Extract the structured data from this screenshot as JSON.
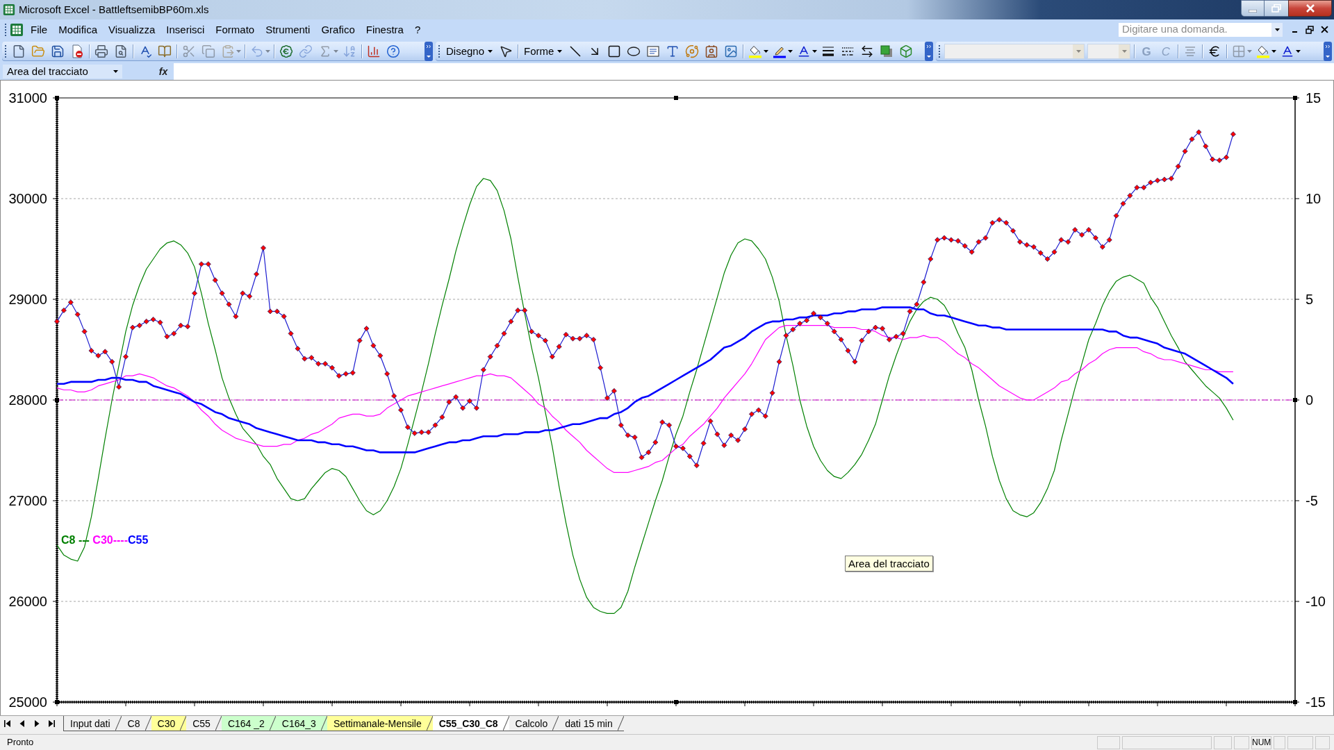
{
  "window": {
    "title": "Microsoft Excel - BattleftsemibBP60m.xls"
  },
  "menu_bar": {
    "items": [
      "File",
      "Modifica",
      "Visualizza",
      "Inserisci",
      "Formato",
      "Strumenti",
      "Grafico",
      "Finestra",
      "?"
    ],
    "help_box": {
      "placeholder": "Digitare una domanda."
    }
  },
  "toolbars": {
    "standard": [
      [
        {
          "kind": "new",
          "disabled": false
        },
        {
          "kind": "open",
          "disabled": false
        },
        {
          "kind": "save",
          "disabled": false
        },
        {
          "kind": "permission",
          "disabled": false
        }
      ],
      [
        {
          "kind": "print",
          "disabled": false
        },
        {
          "kind": "print_preview",
          "disabled": false
        }
      ],
      [
        {
          "kind": "spelling",
          "disabled": false
        },
        {
          "kind": "research",
          "disabled": false
        }
      ],
      [
        {
          "kind": "cut",
          "disabled": true
        },
        {
          "kind": "copy",
          "disabled": true
        },
        {
          "kind": "paste",
          "disabled": true
        }
      ],
      [
        {
          "kind": "undo",
          "disabled": true
        }
      ],
      [
        {
          "kind": "euro_conversion",
          "disabled": false
        },
        {
          "kind": "hyperlink",
          "disabled": true
        },
        {
          "kind": "autosum",
          "disabled": true
        },
        {
          "kind": "sort",
          "disabled": true
        }
      ],
      [
        {
          "kind": "chart_wizard",
          "disabled": false
        },
        {
          "kind": "help",
          "disabled": false
        }
      ]
    ],
    "drawing": [
      [
        {
          "kind": "menu",
          "label": "Disegno",
          "disabled": false
        },
        {
          "kind": "pointer",
          "disabled": false
        }
      ],
      [
        {
          "kind": "menu",
          "label": "Forme",
          "disabled": false
        },
        {
          "kind": "line",
          "disabled": false
        },
        {
          "kind": "arrow",
          "disabled": false
        },
        {
          "kind": "rectangle",
          "disabled": false
        },
        {
          "kind": "oval",
          "disabled": false
        },
        {
          "kind": "text_box",
          "disabled": false
        },
        {
          "kind": "wordart",
          "disabled": false
        },
        {
          "kind": "diagram",
          "disabled": false
        },
        {
          "kind": "clip_art",
          "disabled": false
        },
        {
          "kind": "picture",
          "disabled": false
        }
      ],
      [
        {
          "kind": "fill_color",
          "disabled": false
        },
        {
          "kind": "line_color",
          "disabled": false
        },
        {
          "kind": "font_color",
          "disabled": false
        },
        {
          "kind": "line_style",
          "disabled": false
        },
        {
          "kind": "dash_style",
          "disabled": false
        },
        {
          "kind": "arrow_style",
          "disabled": false
        },
        {
          "kind": "shadow",
          "disabled": false
        },
        {
          "kind": "three_d",
          "disabled": false
        }
      ]
    ],
    "formatting": [
      [
        {
          "kind": "font_combo",
          "disabled": true
        },
        {
          "kind": "size_combo",
          "disabled": true
        }
      ],
      [
        {
          "kind": "bold",
          "label": "G",
          "disabled": true
        },
        {
          "kind": "italic",
          "label": "C",
          "disabled": true
        }
      ],
      [
        {
          "kind": "align",
          "disabled": true
        }
      ],
      [
        {
          "kind": "euro",
          "disabled": false
        }
      ],
      [
        {
          "kind": "borders",
          "disabled": true
        },
        {
          "kind": "fill_color",
          "disabled": false
        },
        {
          "kind": "font_color",
          "disabled": false
        }
      ]
    ]
  },
  "formula_bar": {
    "name_box": "Area del tracciato",
    "function_button": "fx"
  },
  "chart": {
    "plot_area_selected": true,
    "legend_text": [
      {
        "text": "C8 --- ",
        "color": "#008000"
      },
      {
        "text": "C30----",
        "color": "#ff00ff"
      },
      {
        "text": "C55",
        "color": "#0000ff"
      }
    ],
    "tooltip": "Area del tracciato",
    "series_styles": [
      {
        "kind": "thin",
        "color": "#ff0000"
      },
      {
        "kind": "thin"
      },
      {
        "kind": "thin"
      },
      {
        "kind": "thick"
      },
      {
        "kind": "thin"
      }
    ],
    "chart_data": {
      "type": "line",
      "grid": true,
      "ylim": [
        25000,
        31000
      ],
      "yticks": [
        25000,
        26000,
        27000,
        28000,
        29000,
        30000,
        31000
      ],
      "y2lim": [
        -15,
        15
      ],
      "y2ticks": [
        -15,
        -10,
        -5,
        0,
        5,
        10,
        15
      ],
      "series": [
        {
          "color": "#1c1cd0",
          "marker": "diamond",
          "values": [
            28780,
            28890,
            28970,
            28850,
            28680,
            28490,
            28440,
            28480,
            28380,
            28130,
            28430,
            28720,
            28740,
            28780,
            28800,
            28770,
            28630,
            28660,
            28740,
            28730,
            29060,
            29350,
            29350,
            29190,
            29060,
            28950,
            28830,
            29060,
            29030,
            29250,
            29510,
            28880,
            28880,
            28830,
            28660,
            28510,
            28410,
            28420,
            28360,
            28360,
            28320,
            28240,
            28260,
            28270,
            28590,
            28710,
            28540,
            28440,
            28260,
            28040,
            27900,
            27730,
            27670,
            27680,
            27680,
            27750,
            27830,
            27980,
            28030,
            27920,
            27990,
            27920,
            28300,
            28430,
            28540,
            28660,
            28780,
            28890,
            28890,
            28680,
            28640,
            28590,
            28430,
            28530,
            28650,
            28610,
            28610,
            28640,
            28600,
            28320,
            28020,
            28090,
            27750,
            27650,
            27630,
            27430,
            27480,
            27580,
            27780,
            27750,
            27540,
            27520,
            27440,
            27350,
            27570,
            27790,
            27660,
            27550,
            27650,
            27600,
            27710,
            27860,
            27900,
            27840,
            28070,
            28380,
            28640,
            28700,
            28760,
            28790,
            28860,
            28820,
            28760,
            28680,
            28600,
            28490,
            28380,
            28590,
            28680,
            28720,
            28710,
            28600,
            28630,
            28660,
            28880,
            28950,
            29170,
            29400,
            29590,
            29610,
            29590,
            29580,
            29530,
            29470,
            29570,
            29610,
            29760,
            29790,
            29760,
            29680,
            29570,
            29540,
            29520,
            29460,
            29400,
            29470,
            29590,
            29570,
            29690,
            29640,
            29690,
            29610,
            29520,
            29590,
            29830,
            29950,
            30030,
            30110,
            30110,
            30160,
            30180,
            30190,
            30200,
            30320,
            30470,
            30590,
            30660,
            30520,
            30390,
            30380,
            30410,
            30640,
            null,
            null,
            null,
            null,
            null,
            null,
            null,
            null,
            null
          ]
        },
        {
          "color": "#008000",
          "axis": "y2",
          "values": [
            -7.2,
            -7.7,
            -7.9,
            -8.0,
            -7.3,
            -5.8,
            -3.9,
            -1.9,
            0.0,
            1.7,
            3.4,
            4.7,
            5.7,
            6.5,
            7.0,
            7.5,
            7.8,
            7.9,
            7.7,
            7.3,
            6.6,
            5.3,
            3.8,
            2.5,
            1.1,
            0.1,
            -0.7,
            -1.4,
            -1.8,
            -2.2,
            -2.8,
            -3.2,
            -3.9,
            -4.4,
            -4.9,
            -5.0,
            -4.9,
            -4.4,
            -4.0,
            -3.6,
            -3.4,
            -3.5,
            -3.8,
            -4.4,
            -5.0,
            -5.5,
            -5.7,
            -5.5,
            -5.0,
            -4.3,
            -3.4,
            -2.2,
            -0.9,
            0.4,
            1.8,
            3.3,
            4.7,
            6.0,
            7.4,
            8.6,
            9.7,
            10.6,
            11.0,
            10.9,
            10.4,
            9.4,
            8.0,
            6.1,
            4.3,
            2.6,
            1.1,
            -0.6,
            -2.3,
            -4.3,
            -6.1,
            -7.7,
            -8.9,
            -9.8,
            -10.3,
            -10.5,
            -10.6,
            -10.6,
            -10.3,
            -9.5,
            -8.3,
            -7.2,
            -6.1,
            -5.0,
            -4.0,
            -2.8,
            -1.7,
            -0.8,
            0.4,
            1.5,
            2.7,
            3.9,
            5.1,
            6.3,
            7.2,
            7.8,
            8.0,
            7.9,
            7.5,
            7.0,
            6.1,
            4.9,
            3.2,
            1.7,
            0.0,
            -1.3,
            -2.3,
            -3.0,
            -3.5,
            -3.8,
            -3.9,
            -3.6,
            -3.2,
            -2.7,
            -2.0,
            -1.2,
            0.0,
            1.2,
            2.2,
            3.1,
            3.9,
            4.5,
            4.9,
            5.1,
            5.0,
            4.7,
            4.1,
            3.3,
            2.6,
            1.5,
            0.0,
            -1.3,
            -2.8,
            -4.0,
            -4.9,
            -5.5,
            -5.7,
            -5.8,
            -5.6,
            -5.1,
            -4.4,
            -3.5,
            -2.0,
            -0.7,
            0.6,
            1.8,
            3.0,
            3.8,
            4.7,
            5.4,
            5.9,
            6.1,
            6.2,
            6.0,
            5.8,
            5.1,
            4.6,
            3.9,
            3.2,
            2.6,
            1.9,
            1.5,
            1.1,
            0.7,
            0.4,
            0.1,
            -0.4,
            -1.0,
            null,
            null,
            null,
            null,
            null,
            null,
            null,
            null,
            null
          ]
        },
        {
          "color": "#ff00ff",
          "axis": "y2",
          "values": [
            0.6,
            0.5,
            0.5,
            0.4,
            0.4,
            0.5,
            0.7,
            0.8,
            0.9,
            1.0,
            1.2,
            1.2,
            1.3,
            1.2,
            1.1,
            0.9,
            0.7,
            0.6,
            0.4,
            0.2,
            -0.1,
            -0.5,
            -0.8,
            -1.2,
            -1.5,
            -1.7,
            -1.9,
            -2.0,
            -2.1,
            -2.2,
            -2.3,
            -2.3,
            -2.3,
            -2.2,
            -2.2,
            -2.0,
            -1.9,
            -1.7,
            -1.6,
            -1.4,
            -1.2,
            -0.9,
            -0.8,
            -0.7,
            -0.7,
            -0.8,
            -0.8,
            -0.7,
            -0.4,
            -0.2,
            0.0,
            0.2,
            0.3,
            0.4,
            0.5,
            0.6,
            0.7,
            0.8,
            0.9,
            1.0,
            1.1,
            1.2,
            1.2,
            1.3,
            1.2,
            1.2,
            1.1,
            0.8,
            0.5,
            0.2,
            -0.2,
            -0.4,
            -0.8,
            -1.1,
            -1.5,
            -1.8,
            -2.1,
            -2.5,
            -2.8,
            -3.1,
            -3.4,
            -3.6,
            -3.6,
            -3.6,
            -3.5,
            -3.4,
            -3.3,
            -3.1,
            -3.0,
            -2.7,
            -2.4,
            -2.2,
            -1.8,
            -1.5,
            -1.2,
            -0.8,
            -0.4,
            0.1,
            0.5,
            0.9,
            1.3,
            1.8,
            2.4,
            3.0,
            3.3,
            3.6,
            3.7,
            3.7,
            3.7,
            3.7,
            3.7,
            3.7,
            3.7,
            3.6,
            3.6,
            3.6,
            3.6,
            3.5,
            3.5,
            3.4,
            3.2,
            3.1,
            3.1,
            3.0,
            3.1,
            3.1,
            3.2,
            3.1,
            3.1,
            2.9,
            2.6,
            2.3,
            2.1,
            1.8,
            1.6,
            1.3,
            1.0,
            0.7,
            0.5,
            0.3,
            0.1,
            0.0,
            0.0,
            0.2,
            0.4,
            0.6,
            0.9,
            1.0,
            1.3,
            1.5,
            1.8,
            2.0,
            2.3,
            2.5,
            2.6,
            2.6,
            2.6,
            2.6,
            2.4,
            2.3,
            2.1,
            2.0,
            2.0,
            1.9,
            1.8,
            1.7,
            1.6,
            1.5,
            1.5,
            1.4,
            1.4,
            1.4,
            null,
            null,
            null,
            null,
            null,
            null,
            null,
            null,
            null
          ]
        },
        {
          "color": "#0000ff",
          "axis": "y2",
          "values": [
            0.8,
            0.8,
            0.9,
            0.9,
            0.9,
            0.9,
            1.0,
            1.0,
            1.1,
            1.1,
            1.0,
            1.0,
            0.9,
            0.9,
            0.7,
            0.6,
            0.5,
            0.4,
            0.3,
            0.1,
            -0.1,
            -0.2,
            -0.4,
            -0.6,
            -0.7,
            -0.9,
            -1.0,
            -1.1,
            -1.2,
            -1.4,
            -1.5,
            -1.6,
            -1.7,
            -1.8,
            -1.9,
            -2.0,
            -2.0,
            -2.0,
            -2.1,
            -2.1,
            -2.2,
            -2.2,
            -2.3,
            -2.3,
            -2.4,
            -2.5,
            -2.5,
            -2.6,
            -2.6,
            -2.6,
            -2.6,
            -2.6,
            -2.6,
            -2.5,
            -2.4,
            -2.3,
            -2.2,
            -2.1,
            -2.1,
            -2.0,
            -2.0,
            -1.9,
            -1.8,
            -1.8,
            -1.8,
            -1.7,
            -1.7,
            -1.7,
            -1.6,
            -1.6,
            -1.6,
            -1.5,
            -1.5,
            -1.4,
            -1.3,
            -1.2,
            -1.2,
            -1.1,
            -1.0,
            -0.9,
            -0.9,
            -0.7,
            -0.6,
            -0.4,
            -0.1,
            0.1,
            0.2,
            0.4,
            0.6,
            0.8,
            1.0,
            1.2,
            1.4,
            1.6,
            1.8,
            2.0,
            2.3,
            2.6,
            2.7,
            2.9,
            3.1,
            3.4,
            3.6,
            3.8,
            3.9,
            3.9,
            4.0,
            4.0,
            4.1,
            4.1,
            4.2,
            4.2,
            4.2,
            4.3,
            4.3,
            4.4,
            4.4,
            4.5,
            4.5,
            4.5,
            4.6,
            4.6,
            4.6,
            4.6,
            4.6,
            4.5,
            4.5,
            4.3,
            4.2,
            4.2,
            4.1,
            4.0,
            3.9,
            3.8,
            3.7,
            3.7,
            3.6,
            3.6,
            3.5,
            3.5,
            3.5,
            3.5,
            3.5,
            3.5,
            3.5,
            3.5,
            3.5,
            3.5,
            3.5,
            3.5,
            3.5,
            3.5,
            3.5,
            3.4,
            3.4,
            3.2,
            3.1,
            3.1,
            3.0,
            2.9,
            2.8,
            2.6,
            2.5,
            2.4,
            2.3,
            2.1,
            1.9,
            1.7,
            1.5,
            1.3,
            1.1,
            0.8,
            null,
            null,
            null,
            null,
            null,
            null,
            null,
            null,
            null
          ]
        },
        {
          "color": "#cc00cc",
          "axis": "y2",
          "line_style": "dashdot",
          "values": [
            0,
            0,
            0,
            0,
            0,
            0,
            0,
            0,
            0,
            0,
            0,
            0,
            0,
            0,
            0,
            0,
            0,
            0,
            0,
            0,
            0,
            0,
            0,
            0,
            0,
            0,
            0,
            0,
            0,
            0,
            0,
            0,
            0,
            0,
            0,
            0,
            0,
            0,
            0,
            0,
            0,
            0,
            0,
            0,
            0,
            0,
            0,
            0,
            0,
            0,
            0,
            0,
            0,
            0,
            0,
            0,
            0,
            0,
            0,
            0,
            0,
            0,
            0,
            0,
            0,
            0,
            0,
            0,
            0,
            0,
            0,
            0,
            0,
            0,
            0,
            0,
            0,
            0,
            0,
            0,
            0,
            0,
            0,
            0,
            0,
            0,
            0,
            0,
            0,
            0,
            0,
            0,
            0,
            0,
            0,
            0,
            0,
            0,
            0,
            0,
            0,
            0,
            0,
            0,
            0,
            0,
            0,
            0,
            0,
            0,
            0,
            0,
            0,
            0,
            0,
            0,
            0,
            0,
            0,
            0,
            0,
            0,
            0,
            0,
            0,
            0,
            0,
            0,
            0,
            0,
            0,
            0,
            0,
            0,
            0,
            0,
            0,
            0,
            0,
            0,
            0,
            0,
            0,
            0,
            0,
            0,
            0,
            0,
            0,
            0,
            0,
            0,
            0,
            0,
            0,
            0,
            0,
            0,
            0,
            0,
            0,
            0,
            0,
            0,
            0,
            0,
            0,
            0,
            0,
            0,
            0,
            0,
            0,
            0,
            0,
            0,
            0,
            0,
            0,
            0,
            0
          ]
        }
      ]
    }
  },
  "sheet_tabs": [
    {
      "label": "Input dati",
      "selected": false,
      "color": "#f0f0f0"
    },
    {
      "label": "C8",
      "selected": false,
      "color": "#f0f0f0"
    },
    {
      "label": "C30",
      "selected": false,
      "color": "#ffff99"
    },
    {
      "label": "C55",
      "selected": false,
      "color": "#f0f0f0"
    },
    {
      "label": "C164 _2",
      "selected": false,
      "color": "#ccffcc"
    },
    {
      "label": "C164_3",
      "selected": false,
      "color": "#ccffcc"
    },
    {
      "label": "Settimanale-Mensile",
      "selected": false,
      "color": "#ffff99"
    },
    {
      "label": "C55_C30_C8",
      "selected": true,
      "color": "#ffffff"
    },
    {
      "label": "Calcolo",
      "selected": false,
      "color": "#f0f0f0"
    },
    {
      "label": "dati 15 min",
      "selected": false,
      "color": "#f0f0f0"
    }
  ],
  "status_bar": {
    "message": "Pronto",
    "num_lock": "NUM"
  }
}
